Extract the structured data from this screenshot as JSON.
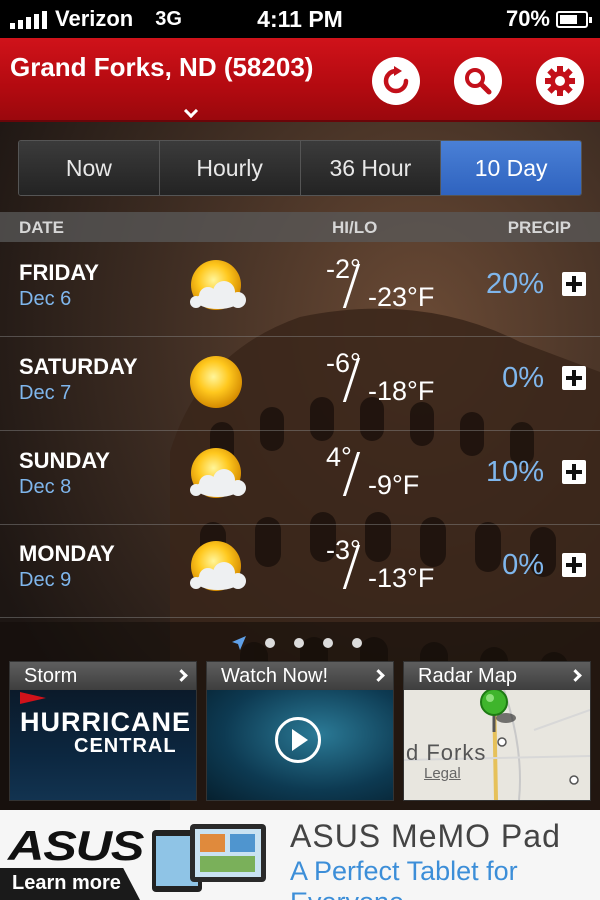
{
  "status_bar": {
    "carrier": "Verizon",
    "network": "3G",
    "time": "4:11 PM",
    "battery_percent": "70%",
    "battery_level": 0.7
  },
  "header": {
    "location": "Grand Forks, ND (58203)",
    "refresh_icon": "refresh-icon",
    "search_icon": "search-icon",
    "settings_icon": "gear-icon",
    "accent_color": "#c3101a"
  },
  "tabs": [
    {
      "label": "Now",
      "active": false
    },
    {
      "label": "Hourly",
      "active": false
    },
    {
      "label": "36 Hour",
      "active": false
    },
    {
      "label": "10 Day",
      "active": true
    }
  ],
  "table_header": {
    "date": "DATE",
    "hilo": "HI/LO",
    "precip": "PRECIP"
  },
  "forecast": [
    {
      "day": "FRIDAY",
      "date": "Dec 6",
      "hi": "-2°",
      "lo": "-23°F",
      "precip": "20%",
      "icon": "partly-cloudy-icon"
    },
    {
      "day": "SATURDAY",
      "date": "Dec 7",
      "hi": "-6°",
      "lo": "-18°F",
      "precip": "0%",
      "icon": "sunny-icon"
    },
    {
      "day": "SUNDAY",
      "date": "Dec 8",
      "hi": "4°",
      "lo": "-9°F",
      "precip": "10%",
      "icon": "partly-cloudy-icon"
    },
    {
      "day": "MONDAY",
      "date": "Dec 9",
      "hi": "-3°",
      "lo": "-13°F",
      "precip": "0%",
      "icon": "partly-cloudy-icon"
    }
  ],
  "pager": {
    "pages": 5,
    "current": 0
  },
  "cards": [
    {
      "title": "Storm",
      "line1": "HURRICANE",
      "line2": "CENTRAL"
    },
    {
      "title": "Watch Now!"
    },
    {
      "title": "Radar Map",
      "map_label": "d Forks",
      "legal": "Legal"
    }
  ],
  "ad": {
    "brand": "ASUS",
    "cta": "Learn more",
    "title": "ASUS MeMO Pad",
    "tagline": "A Perfect Tablet for Everyone"
  }
}
